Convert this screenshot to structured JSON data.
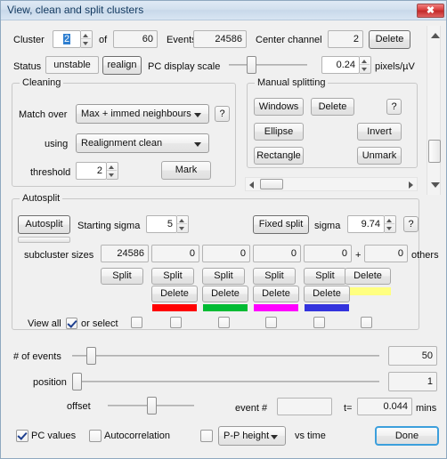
{
  "window": {
    "title": "View, clean and split clusters",
    "close_label": "✖"
  },
  "top": {
    "cluster_label": "Cluster",
    "cluster_value": "2",
    "of_label": "of",
    "of_value": "60",
    "events_label": "Events",
    "events_value": "24586",
    "center_channel_label": "Center channel",
    "center_channel_value": "2",
    "delete_label": "Delete",
    "status_label": "Status",
    "status_value": "unstable",
    "realign_label": "realign",
    "pc_display_scale_label": "PC display scale",
    "pc_display_scale_value": "0.24",
    "pc_display_scale_units": "pixels/µV"
  },
  "cleaning": {
    "title": "Cleaning",
    "match_over_label": "Match over",
    "match_over_value": "Max  + immed neighbours",
    "help_label": "?",
    "using_label": "using",
    "using_value": "Realignment clean",
    "threshold_label": "threshold",
    "threshold_value": "2",
    "mark_label": "Mark"
  },
  "manual_splitting": {
    "title": "Manual splitting",
    "windows_label": "Windows",
    "delete_label": "Delete",
    "help_label": "?",
    "ellipse_label": "Ellipse",
    "invert_label": "Invert",
    "rectangle_label": "Rectangle",
    "unmark_label": "Unmark"
  },
  "autosplit": {
    "title": "Autosplit",
    "autosplit_label": "Autosplit",
    "starting_sigma_label": "Starting sigma",
    "starting_sigma_value": "5",
    "fixed_split_label": "Fixed split",
    "sigma_label": "sigma",
    "sigma_value": "9.74",
    "help_label": "?",
    "subcluster_sizes_label": "subcluster sizes",
    "subcluster_sizes": [
      "24586",
      "0",
      "0",
      "0",
      "0"
    ],
    "plus_label": "+",
    "others_value": "0",
    "others_label": "others",
    "split_label": "Split",
    "split_buttons": [
      "Split",
      "Split",
      "Split",
      "Split",
      "Split"
    ],
    "delete_top_label": "Delete",
    "delete_buttons": [
      "Delete",
      "Delete",
      "Delete",
      "Delete"
    ],
    "colors": [
      "#ff0000",
      "#00bb33",
      "#ff00ff",
      "#3333dd"
    ],
    "highlight_color": "#ffff80",
    "view_all_label": "View all",
    "view_all_checked": true,
    "or_select_label": "or select",
    "select_checkboxes": [
      false,
      false,
      false,
      false,
      false,
      false
    ]
  },
  "sliders": {
    "events_label": "# of events",
    "events_value": "50",
    "position_label": "position",
    "position_value": "1",
    "offset_label": "offset",
    "event_num_label": "event #",
    "event_num_value": "",
    "t_label": "t=",
    "t_value": "0.044",
    "t_units": "mins"
  },
  "footer": {
    "pc_values_label": "PC values",
    "pc_values_checked": true,
    "autocorrelation_label": "Autocorrelation",
    "autocorrelation_checked": false,
    "vs_time_checkbox_checked": false,
    "measure_value": "P-P height",
    "vs_time_label": "vs time",
    "done_label": "Done"
  }
}
